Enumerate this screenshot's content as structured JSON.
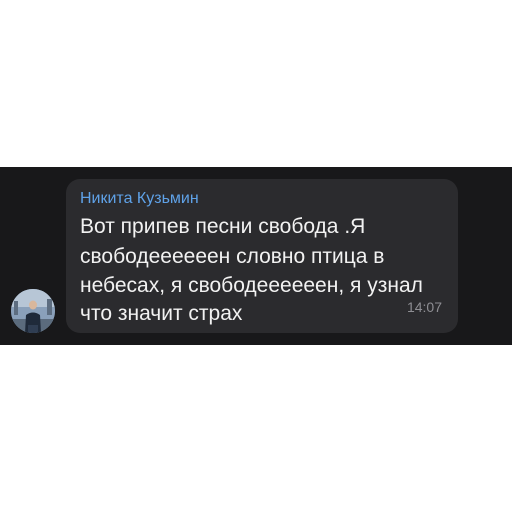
{
  "message": {
    "sender_name": "Никита Кузьмин",
    "text_lines": [
      "Вот припев песни свобода .Я",
      "свободеееееен словно птица в",
      "небесах,  я свободеееееен, я узнал",
      "что значит страх"
    ],
    "time": "14:07"
  },
  "colors": {
    "background": "#18181a",
    "bubble": "#2b2b2e",
    "sender_name": "#5fa2e8",
    "message_text": "#f2f2f2",
    "timestamp": "#8e8e93"
  },
  "icons": {
    "avatar": "user-avatar-photo"
  }
}
